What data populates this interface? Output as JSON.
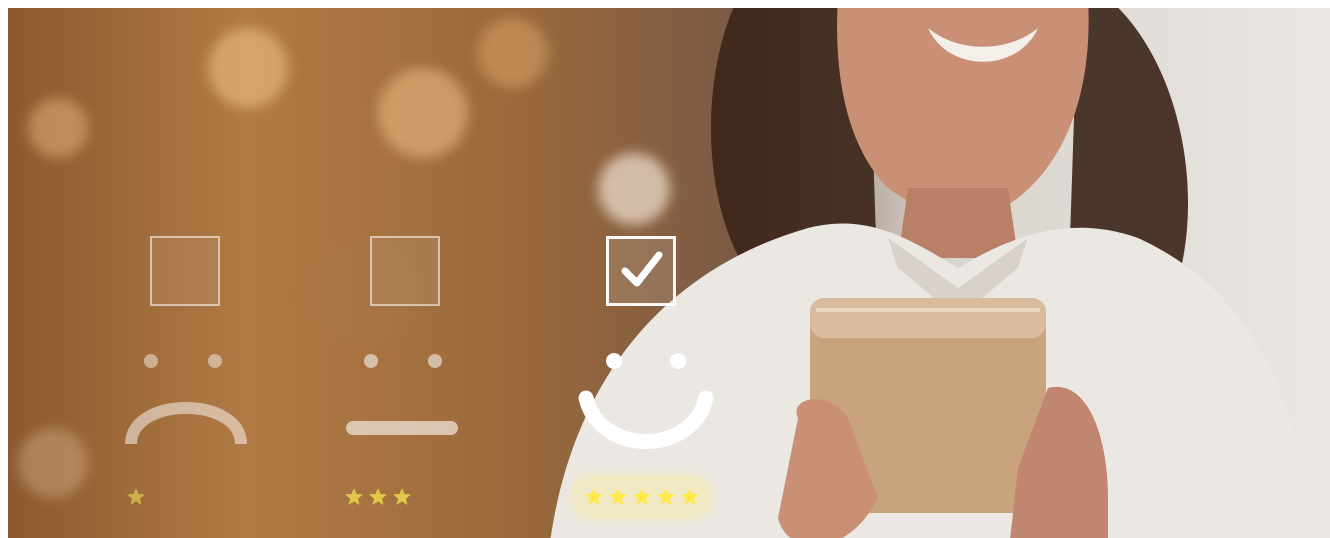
{
  "image": {
    "description_free": true
  },
  "rating_options": [
    {
      "mood": "sad",
      "checked": false,
      "stars": 1,
      "star_color": "#c9b04a"
    },
    {
      "mood": "neutral",
      "checked": false,
      "stars": 3,
      "star_color": "#e0c64a"
    },
    {
      "mood": "happy",
      "checked": true,
      "stars": 5,
      "star_color": "#ffe94a"
    }
  ],
  "icons": {
    "checkbox": "checkbox-icon",
    "check": "check-icon",
    "star": "star-icon",
    "sad_face": "sad-face-icon",
    "neutral_face": "neutral-face-icon",
    "happy_face": "happy-face-icon",
    "phone": "smartphone-icon"
  },
  "colors": {
    "bokeh_warm": "#b07a45",
    "shirt": "#ebe7e3",
    "phone": "#c9a27e",
    "hair": "#3b2418",
    "skin": "#c99076",
    "overlay_white": "#ffffff",
    "star_highlight": "#ffe94a"
  }
}
